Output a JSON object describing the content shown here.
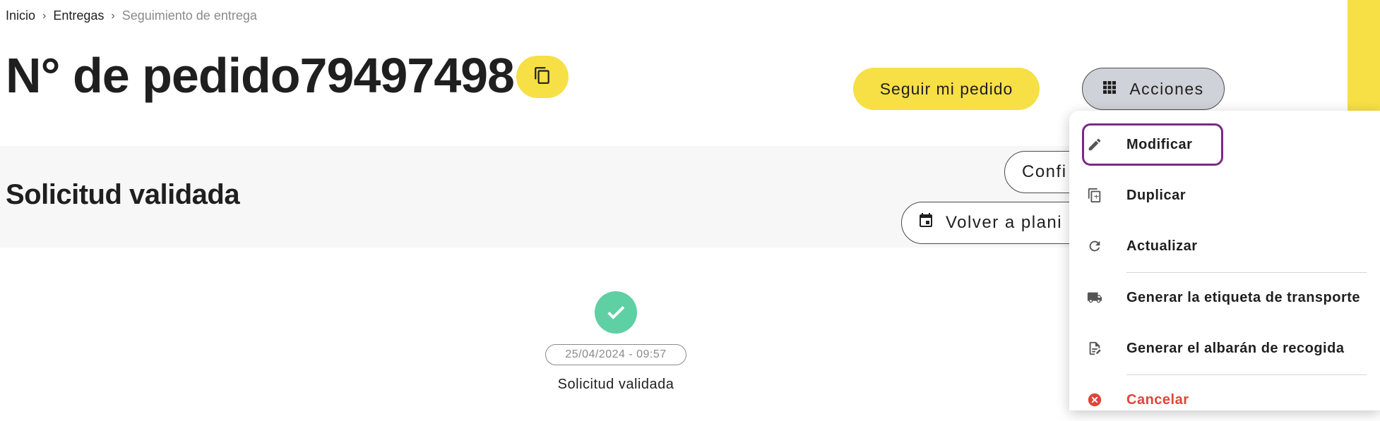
{
  "breadcrumb": {
    "items": [
      "Inicio",
      "Entregas",
      "Seguimiento de entrega"
    ]
  },
  "header": {
    "title": "N° de pedido79497498",
    "follow_label": "Seguir mi pedido",
    "actions_label": "Acciones"
  },
  "status": {
    "title": "Solicitud validada",
    "confirm_label": "Confi",
    "replan_label": "Volver a plani"
  },
  "timeline": {
    "date": "25/04/2024 - 09:57",
    "label": "Solicitud validada"
  },
  "menu": {
    "items": [
      {
        "label": "Modificar",
        "icon": "pencil-icon"
      },
      {
        "label": "Duplicar",
        "icon": "duplicate-icon"
      },
      {
        "label": "Actualizar",
        "icon": "refresh-icon"
      },
      {
        "label": "Generar la etiqueta de transporte",
        "icon": "truck-icon"
      },
      {
        "label": "Generar el albarán de recogida",
        "icon": "document-edit-icon"
      },
      {
        "label": "Cancelar",
        "icon": "cancel-icon"
      }
    ]
  },
  "colors": {
    "accent_yellow": "#f7df46",
    "success_green": "#5fcfa4",
    "danger_red": "#e0453a",
    "focus_purple": "#7a2a86"
  }
}
